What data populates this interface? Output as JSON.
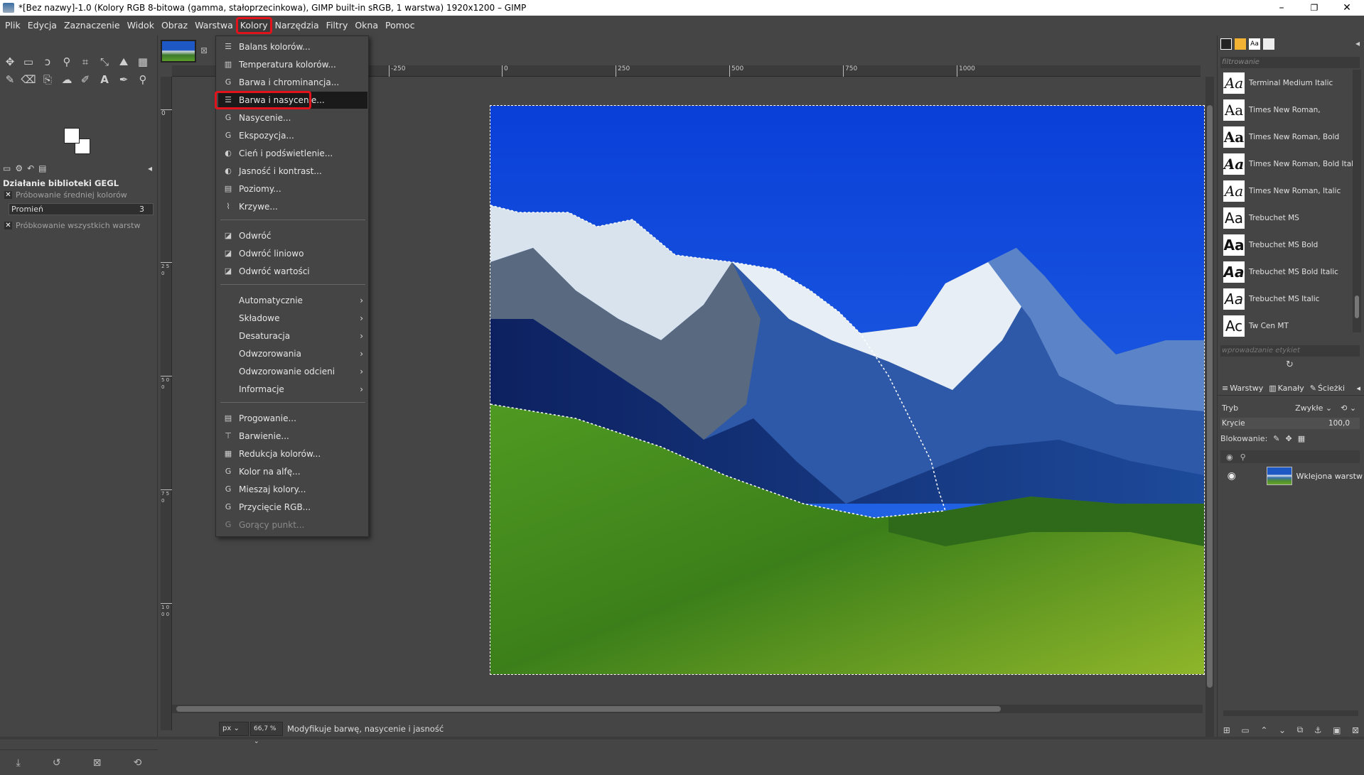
{
  "window": {
    "title": "*[Bez nazwy]-1.0 (Kolory RGB 8-bitowa (gamma, stałoprzecinkowa), GIMP built-in sRGB, 1 warstwa) 1920x1200 – GIMP",
    "minimize": "–",
    "maximize": "❐",
    "close": "✕"
  },
  "menubar": [
    "Plik",
    "Edycja",
    "Zaznaczenie",
    "Widok",
    "Obraz",
    "Warstwa",
    "Kolory",
    "Narzędzia",
    "Filtry",
    "Okna",
    "Pomoc"
  ],
  "active_menu": "Kolory",
  "kolory_menu": {
    "group1": [
      {
        "label": "Balans kolorów...",
        "icon": "sliders-icon"
      },
      {
        "label": "Temperatura kolorów...",
        "icon": "thermometer-icon"
      },
      {
        "label": "Barwa i chrominancja...",
        "icon": "gegl-icon"
      },
      {
        "label": "Barwa i nasycenie...",
        "icon": "sliders-icon",
        "highlighted": true
      },
      {
        "label": "Nasycenie...",
        "icon": "gegl-icon"
      },
      {
        "label": "Ekspozycja...",
        "icon": "gegl-icon"
      },
      {
        "label": "Cień i podświetlenie...",
        "icon": "contrast-icon"
      },
      {
        "label": "Jasność i kontrast...",
        "icon": "contrast-icon"
      },
      {
        "label": "Poziomy...",
        "icon": "levels-icon"
      },
      {
        "label": "Krzywe...",
        "icon": "curves-icon"
      }
    ],
    "group2": [
      {
        "label": "Odwróć",
        "icon": "invert-icon"
      },
      {
        "label": "Odwróć liniowo",
        "icon": "invert-icon"
      },
      {
        "label": "Odwróć wartości",
        "icon": "invert-icon"
      }
    ],
    "group3": [
      {
        "label": "Automatycznie"
      },
      {
        "label": "Składowe"
      },
      {
        "label": "Desaturacja"
      },
      {
        "label": "Odwzorowania"
      },
      {
        "label": "Odwzorowanie odcieni"
      },
      {
        "label": "Informacje"
      }
    ],
    "group4": [
      {
        "label": "Progowanie...",
        "icon": "threshold-icon"
      },
      {
        "label": "Barwienie...",
        "icon": "colorize-icon"
      },
      {
        "label": "Redukcja kolorów...",
        "icon": "posterize-icon"
      },
      {
        "label": "Kolor na alfę...",
        "icon": "gegl-icon"
      },
      {
        "label": "Mieszaj kolory...",
        "icon": "gegl-icon"
      },
      {
        "label": "Przycięcie RGB...",
        "icon": "gegl-icon"
      },
      {
        "label": "Gorący punkt...",
        "icon": "gegl-icon",
        "disabled": true
      }
    ],
    "submenu_arrow": "›"
  },
  "tool_options": {
    "title": "Działanie biblioteki GEGL",
    "sample_average": "Próbowanie średniej kolorów",
    "radius_label": "Promień",
    "radius_value": "3",
    "sample_merged": "Próbkowanie wszystkich warstw"
  },
  "rulers": {
    "h_ticks": [
      "-250",
      "0",
      "250",
      "500",
      "750",
      "1000"
    ],
    "v_ticks": [
      "0",
      "2 5 0",
      "5 0 0",
      "7 5 0",
      "1 0 0 0"
    ]
  },
  "statusbar": {
    "unit": "px",
    "zoom": "66,7 %",
    "message": "Modyfikuje barwę, nasycenie i jasność"
  },
  "fonts_panel": {
    "filter_placeholder": "filtrowanie",
    "tag_placeholder": "wprowadzanie etykiet",
    "fonts": [
      {
        "name": "Terminal Medium Italic",
        "preview": "Aa"
      },
      {
        "name": "Times New Roman,",
        "preview": "Aa"
      },
      {
        "name": "Times New Roman, Bold",
        "preview": "Aa"
      },
      {
        "name": "Times New Roman, Bold Itali",
        "preview": "Aa"
      },
      {
        "name": "Times New Roman, Italic",
        "preview": "Aa"
      },
      {
        "name": "Trebuchet MS",
        "preview": "Aa"
      },
      {
        "name": "Trebuchet MS Bold",
        "preview": "Aa"
      },
      {
        "name": "Trebuchet MS Bold Italic",
        "preview": "Aa"
      },
      {
        "name": "Trebuchet MS Italic",
        "preview": "Aa"
      },
      {
        "name": "Tw Cen MT",
        "preview": "Ac"
      }
    ]
  },
  "layers_panel": {
    "tabs": [
      "Warstwy",
      "Kanały",
      "Ścieżki"
    ],
    "mode_label": "Tryb",
    "mode_value": "Zwykłe",
    "opacity_label": "Krycie",
    "opacity_value": "100,0",
    "lock_label": "Blokowanie:",
    "layer_name": "Wklejona warstw"
  },
  "colors": {
    "selection_highlight": "#e3131c",
    "menu_bg": "#454545",
    "highlight_bg": "#1a1a1a"
  }
}
